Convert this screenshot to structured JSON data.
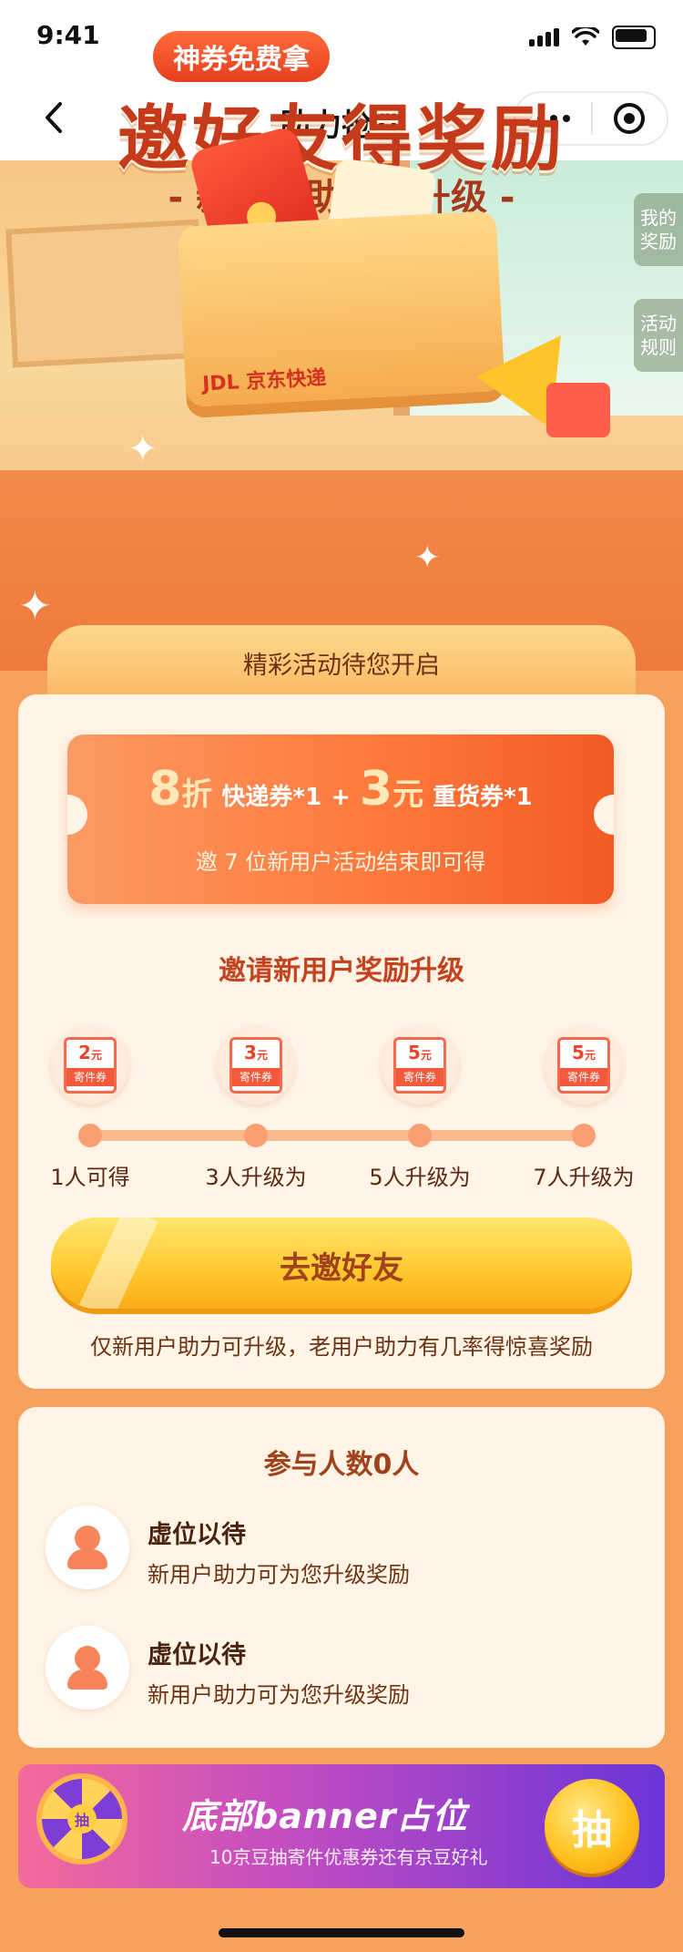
{
  "status_bar": {
    "time": "9:41"
  },
  "nav": {
    "title": "助力抢券"
  },
  "hero": {
    "badge": "神券免费拿",
    "title": "邀好友得奖励",
    "subtitle": "- 新用户助力可升级 -",
    "side_my_rewards": "我的\n奖励",
    "side_rules": "活动\n规则",
    "box_logo": "JDL 京东快递"
  },
  "section_header": "精彩活动待您开启",
  "coupon": {
    "discount_num": "8",
    "discount_unit": "折",
    "discount_name": "快递券*1",
    "plus": "+",
    "amount_num": "3",
    "amount_unit": "元",
    "amount_name": "重货券*1",
    "condition": "邀 7 位新用户活动结束即可得"
  },
  "upgrade_title": "邀请新用户奖励升级",
  "rewards": [
    {
      "value": "2",
      "unit": "元",
      "label": "寄件券",
      "step": "1人可得"
    },
    {
      "value": "3",
      "unit": "元",
      "label": "寄件券",
      "step": "3人升级为"
    },
    {
      "value": "5",
      "unit": "元",
      "label": "寄件券",
      "step": "5人升级为"
    },
    {
      "value": "5",
      "unit": "元",
      "label": "寄件券",
      "step": "7人升级为"
    }
  ],
  "invite_button": "去邀好友",
  "tip": "仅新用户助力可升级，老用户助力有几率得惊喜奖励",
  "participants": {
    "title": "参与人数0人",
    "items": [
      {
        "name": "虚位以待",
        "desc": "新用户助力可为您升级奖励"
      },
      {
        "name": "虚位以待",
        "desc": "新用户助力可为您升级奖励"
      }
    ]
  },
  "banner": {
    "title": "底部banner占位",
    "subtitle": "10京豆抽寄件优惠券还有京豆好礼",
    "button": "抽",
    "wheel_center": "抽"
  },
  "colors": {
    "accent": "#f15b25",
    "page_bg": "#f7a15f",
    "card_bg": "#fff4e6",
    "button_yellow": "#ffc82e"
  }
}
